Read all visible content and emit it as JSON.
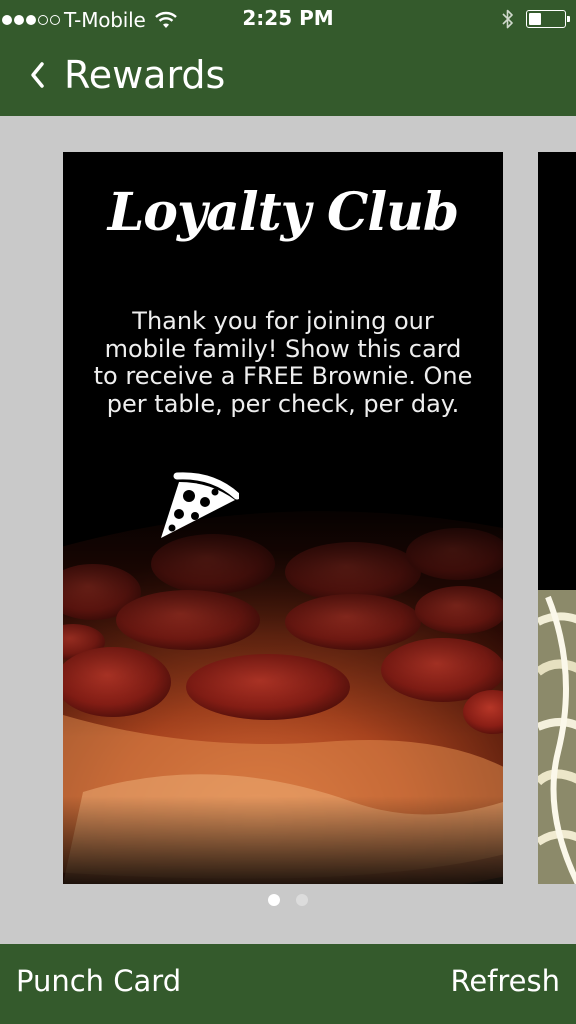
{
  "status_bar": {
    "signal_filled": 3,
    "signal_total": 5,
    "carrier": "T-Mobile",
    "time": "2:25 PM",
    "battery_level": 0.35,
    "icons": [
      "wifi-icon",
      "bluetooth-icon",
      "battery-icon"
    ]
  },
  "nav": {
    "back_icon": "chevron-left-icon",
    "title": "Rewards"
  },
  "card": {
    "title": "Loyalty Club",
    "message": "Thank you for joining our mobile family! Show this card to receive a FREE Brownie. One per table, per check, per day.",
    "icon": "pizza-slice-icon"
  },
  "pager": {
    "count": 2,
    "active_index": 0
  },
  "bottom_bar": {
    "left_label": "Punch Card",
    "right_label": "Refresh"
  },
  "colors": {
    "header_green": "#345a2c",
    "background_gray": "#c9c9c9"
  }
}
